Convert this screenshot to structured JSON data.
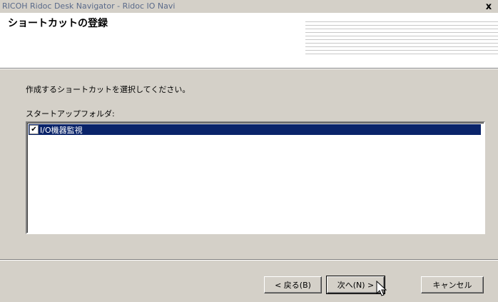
{
  "window": {
    "title": "RICOH Ridoc Desk Navigator - Ridoc IO Navi",
    "close_label": "x"
  },
  "header": {
    "title": "ショートカットの登録"
  },
  "main": {
    "instruction": "作成するショートカットを選択してください。",
    "folder_label": "スタートアップフォルダ:",
    "items": [
      {
        "label": "I/O機器監視",
        "checked": true,
        "selected": true
      }
    ]
  },
  "buttons": {
    "back": "< 戻る(B)",
    "next": "次へ(N) >",
    "cancel": "キャンセル"
  },
  "colors": {
    "selection": "#0a246a",
    "dialog_bg": "#d4d0c8"
  }
}
